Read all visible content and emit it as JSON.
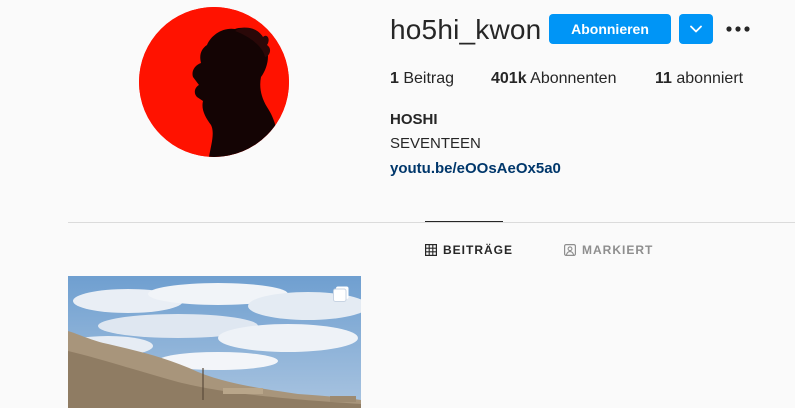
{
  "profile": {
    "username": "ho5hi_kwon",
    "follow_label": "Abonnieren",
    "full_name": "HOSHI",
    "bio": "SEVENTEEN",
    "link": "youtu.be/eOOsAeOx5a0",
    "avatar_color": "#ff0000"
  },
  "stats": {
    "posts_count": "1",
    "posts_label": "Beitrag",
    "followers_count": "401k",
    "followers_label": "Abonnenten",
    "following_count": "11",
    "following_label": "abonniert"
  },
  "tabs": [
    {
      "label": "BEITRÄGE",
      "icon": "grid-icon",
      "active": true
    },
    {
      "label": "MARKIERT",
      "icon": "tagged-icon",
      "active": false
    }
  ],
  "colors": {
    "accent": "#0095f6",
    "link": "#00376b",
    "background": "#fafafa"
  }
}
